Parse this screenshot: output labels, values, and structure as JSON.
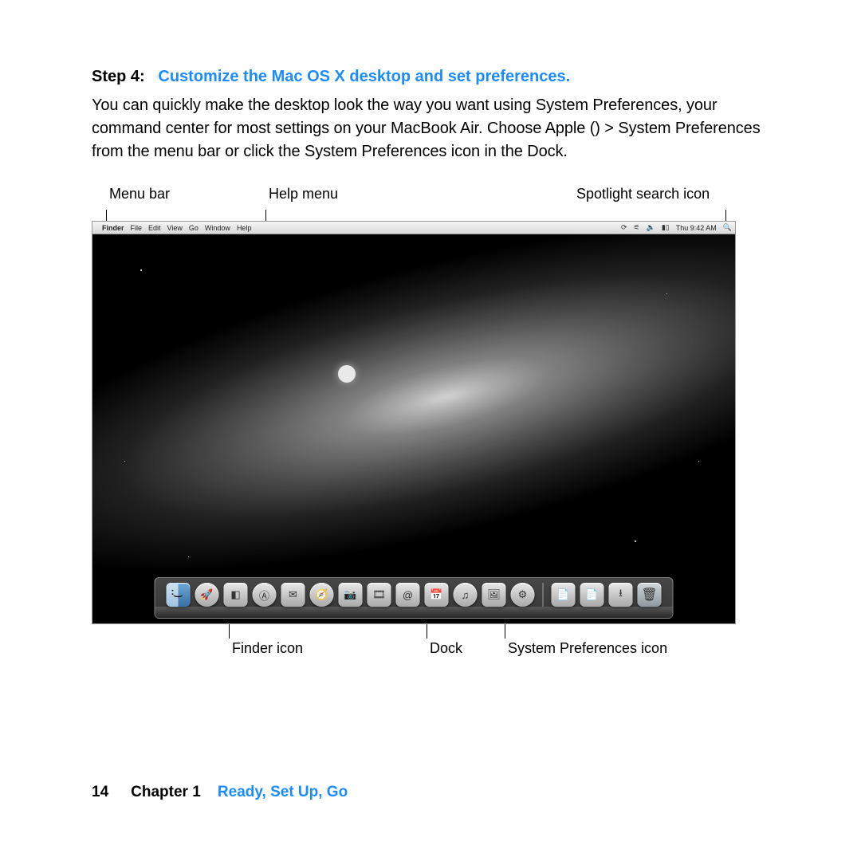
{
  "heading": {
    "prefix": "Step 4:",
    "title": "Customize the Mac OS X desktop and set preferences."
  },
  "body": "You can quickly make the desktop look the way you want using System Preferences, your command center for most settings on your MacBook Air. Choose Apple () > System Preferences from the menu bar or click the System Preferences icon in the Dock.",
  "callouts_top": {
    "menubar": "Menu bar",
    "helpmenu": "Help menu",
    "spotlight": "Spotlight search icon"
  },
  "menubar": {
    "app": "Finder",
    "items": [
      "File",
      "Edit",
      "View",
      "Go",
      "Window",
      "Help"
    ],
    "clock": "Thu 9:42 AM"
  },
  "dock_icons": [
    {
      "name": "finder-icon",
      "glyph": ""
    },
    {
      "name": "launchpad-icon",
      "glyph": "🚀"
    },
    {
      "name": "mission-control-icon",
      "glyph": "◧"
    },
    {
      "name": "app-store-icon",
      "glyph": "Ⓐ"
    },
    {
      "name": "mail-icon",
      "glyph": "✉"
    },
    {
      "name": "safari-icon",
      "glyph": "🧭"
    },
    {
      "name": "facetime-icon",
      "glyph": "📷"
    },
    {
      "name": "photo-booth-icon",
      "glyph": "🎞"
    },
    {
      "name": "address-book-icon",
      "glyph": "@"
    },
    {
      "name": "ical-icon",
      "glyph": "📅"
    },
    {
      "name": "itunes-icon",
      "glyph": "♫"
    },
    {
      "name": "iphoto-icon",
      "glyph": "🖼"
    },
    {
      "name": "system-preferences-icon",
      "glyph": "⚙"
    }
  ],
  "dock_right": [
    {
      "name": "document-icon",
      "glyph": "📄"
    },
    {
      "name": "document2-icon",
      "glyph": "📄"
    },
    {
      "name": "downloads-icon",
      "glyph": "⭳"
    }
  ],
  "callouts_bottom": {
    "finder": "Finder icon",
    "dock": "Dock",
    "sysprefs": "System Preferences icon"
  },
  "footer": {
    "page": "14",
    "chapter": "Chapter 1",
    "title": "Ready, Set Up, Go"
  }
}
